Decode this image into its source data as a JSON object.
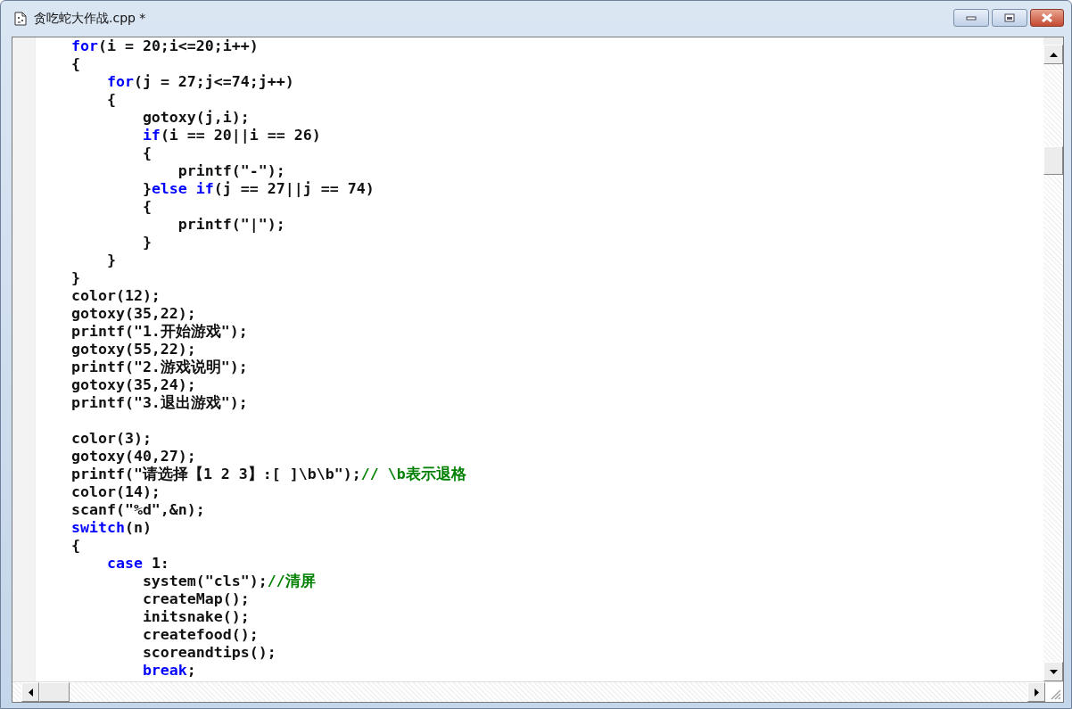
{
  "window": {
    "title": "贪吃蛇大作战.cpp *"
  },
  "editor": {
    "lines": [
      {
        "kind": "code",
        "tokens": [
          {
            "kind": "keyword",
            "text": "    for"
          },
          {
            "kind": "plain",
            "text": "(i = 20;i<=20;i++)"
          }
        ]
      },
      {
        "kind": "code",
        "tokens": [
          {
            "kind": "plain",
            "text": "    {"
          }
        ]
      },
      {
        "kind": "code",
        "tokens": [
          {
            "kind": "keyword",
            "text": "        for"
          },
          {
            "kind": "plain",
            "text": "(j = 27;j<=74;j++)"
          }
        ]
      },
      {
        "kind": "code",
        "tokens": [
          {
            "kind": "plain",
            "text": "        {"
          }
        ]
      },
      {
        "kind": "code",
        "tokens": [
          {
            "kind": "plain",
            "text": "            gotoxy(j,i);"
          }
        ]
      },
      {
        "kind": "code",
        "tokens": [
          {
            "kind": "keyword",
            "text": "            if"
          },
          {
            "kind": "plain",
            "text": "(i == 20||i == 26)"
          }
        ]
      },
      {
        "kind": "code",
        "tokens": [
          {
            "kind": "plain",
            "text": "            {"
          }
        ]
      },
      {
        "kind": "code",
        "tokens": [
          {
            "kind": "plain",
            "text": "                printf(\"-\");"
          }
        ]
      },
      {
        "kind": "code",
        "tokens": [
          {
            "kind": "plain",
            "text": "            }"
          },
          {
            "kind": "keyword",
            "text": "else if"
          },
          {
            "kind": "plain",
            "text": "(j == 27||j == 74)"
          }
        ]
      },
      {
        "kind": "code",
        "tokens": [
          {
            "kind": "plain",
            "text": "            {"
          }
        ]
      },
      {
        "kind": "code",
        "tokens": [
          {
            "kind": "plain",
            "text": "                printf(\"|\");"
          }
        ]
      },
      {
        "kind": "code",
        "tokens": [
          {
            "kind": "plain",
            "text": "            }"
          }
        ]
      },
      {
        "kind": "code",
        "tokens": [
          {
            "kind": "plain",
            "text": "        }"
          }
        ]
      },
      {
        "kind": "code",
        "tokens": [
          {
            "kind": "plain",
            "text": "    }"
          }
        ]
      },
      {
        "kind": "code",
        "tokens": [
          {
            "kind": "plain",
            "text": "    color(12);"
          }
        ]
      },
      {
        "kind": "code",
        "tokens": [
          {
            "kind": "plain",
            "text": "    gotoxy(35,22);"
          }
        ]
      },
      {
        "kind": "code",
        "tokens": [
          {
            "kind": "plain",
            "text": "    printf(\"1.开始游戏\");"
          }
        ]
      },
      {
        "kind": "code",
        "tokens": [
          {
            "kind": "plain",
            "text": "    gotoxy(55,22);"
          }
        ]
      },
      {
        "kind": "code",
        "tokens": [
          {
            "kind": "plain",
            "text": "    printf(\"2.游戏说明\");"
          }
        ]
      },
      {
        "kind": "code",
        "tokens": [
          {
            "kind": "plain",
            "text": "    gotoxy(35,24);"
          }
        ]
      },
      {
        "kind": "code",
        "tokens": [
          {
            "kind": "plain",
            "text": "    printf(\"3.退出游戏\");"
          }
        ]
      },
      {
        "kind": "blank"
      },
      {
        "kind": "code",
        "tokens": [
          {
            "kind": "plain",
            "text": "    color(3);"
          }
        ]
      },
      {
        "kind": "code",
        "tokens": [
          {
            "kind": "plain",
            "text": "    gotoxy(40,27);"
          }
        ]
      },
      {
        "kind": "code",
        "tokens": [
          {
            "kind": "plain",
            "text": "    printf(\"请选择【1 2 3】:[ ]\\b\\b\");"
          },
          {
            "kind": "comment",
            "text": "// \\b表示退格"
          }
        ]
      },
      {
        "kind": "code",
        "tokens": [
          {
            "kind": "plain",
            "text": "    color(14);"
          }
        ]
      },
      {
        "kind": "code",
        "tokens": [
          {
            "kind": "plain",
            "text": "    scanf(\"%d\",&n);"
          }
        ]
      },
      {
        "kind": "code",
        "tokens": [
          {
            "kind": "keyword",
            "text": "    switch"
          },
          {
            "kind": "plain",
            "text": "(n)"
          }
        ]
      },
      {
        "kind": "code",
        "tokens": [
          {
            "kind": "plain",
            "text": "    {"
          }
        ]
      },
      {
        "kind": "code",
        "tokens": [
          {
            "kind": "keyword",
            "text": "        case"
          },
          {
            "kind": "plain",
            "text": " 1:"
          }
        ]
      },
      {
        "kind": "code",
        "tokens": [
          {
            "kind": "plain",
            "text": "            system(\"cls\");"
          },
          {
            "kind": "comment",
            "text": "//清屏"
          }
        ]
      },
      {
        "kind": "code",
        "tokens": [
          {
            "kind": "plain",
            "text": "            createMap();"
          }
        ]
      },
      {
        "kind": "code",
        "tokens": [
          {
            "kind": "plain",
            "text": "            initsnake();"
          }
        ]
      },
      {
        "kind": "code",
        "tokens": [
          {
            "kind": "plain",
            "text": "            createfood();"
          }
        ]
      },
      {
        "kind": "code",
        "tokens": [
          {
            "kind": "plain",
            "text": "            scoreandtips();"
          }
        ]
      },
      {
        "kind": "code",
        "tokens": [
          {
            "kind": "keyword",
            "text": "            break"
          },
          {
            "kind": "plain",
            "text": ";"
          }
        ]
      }
    ]
  }
}
